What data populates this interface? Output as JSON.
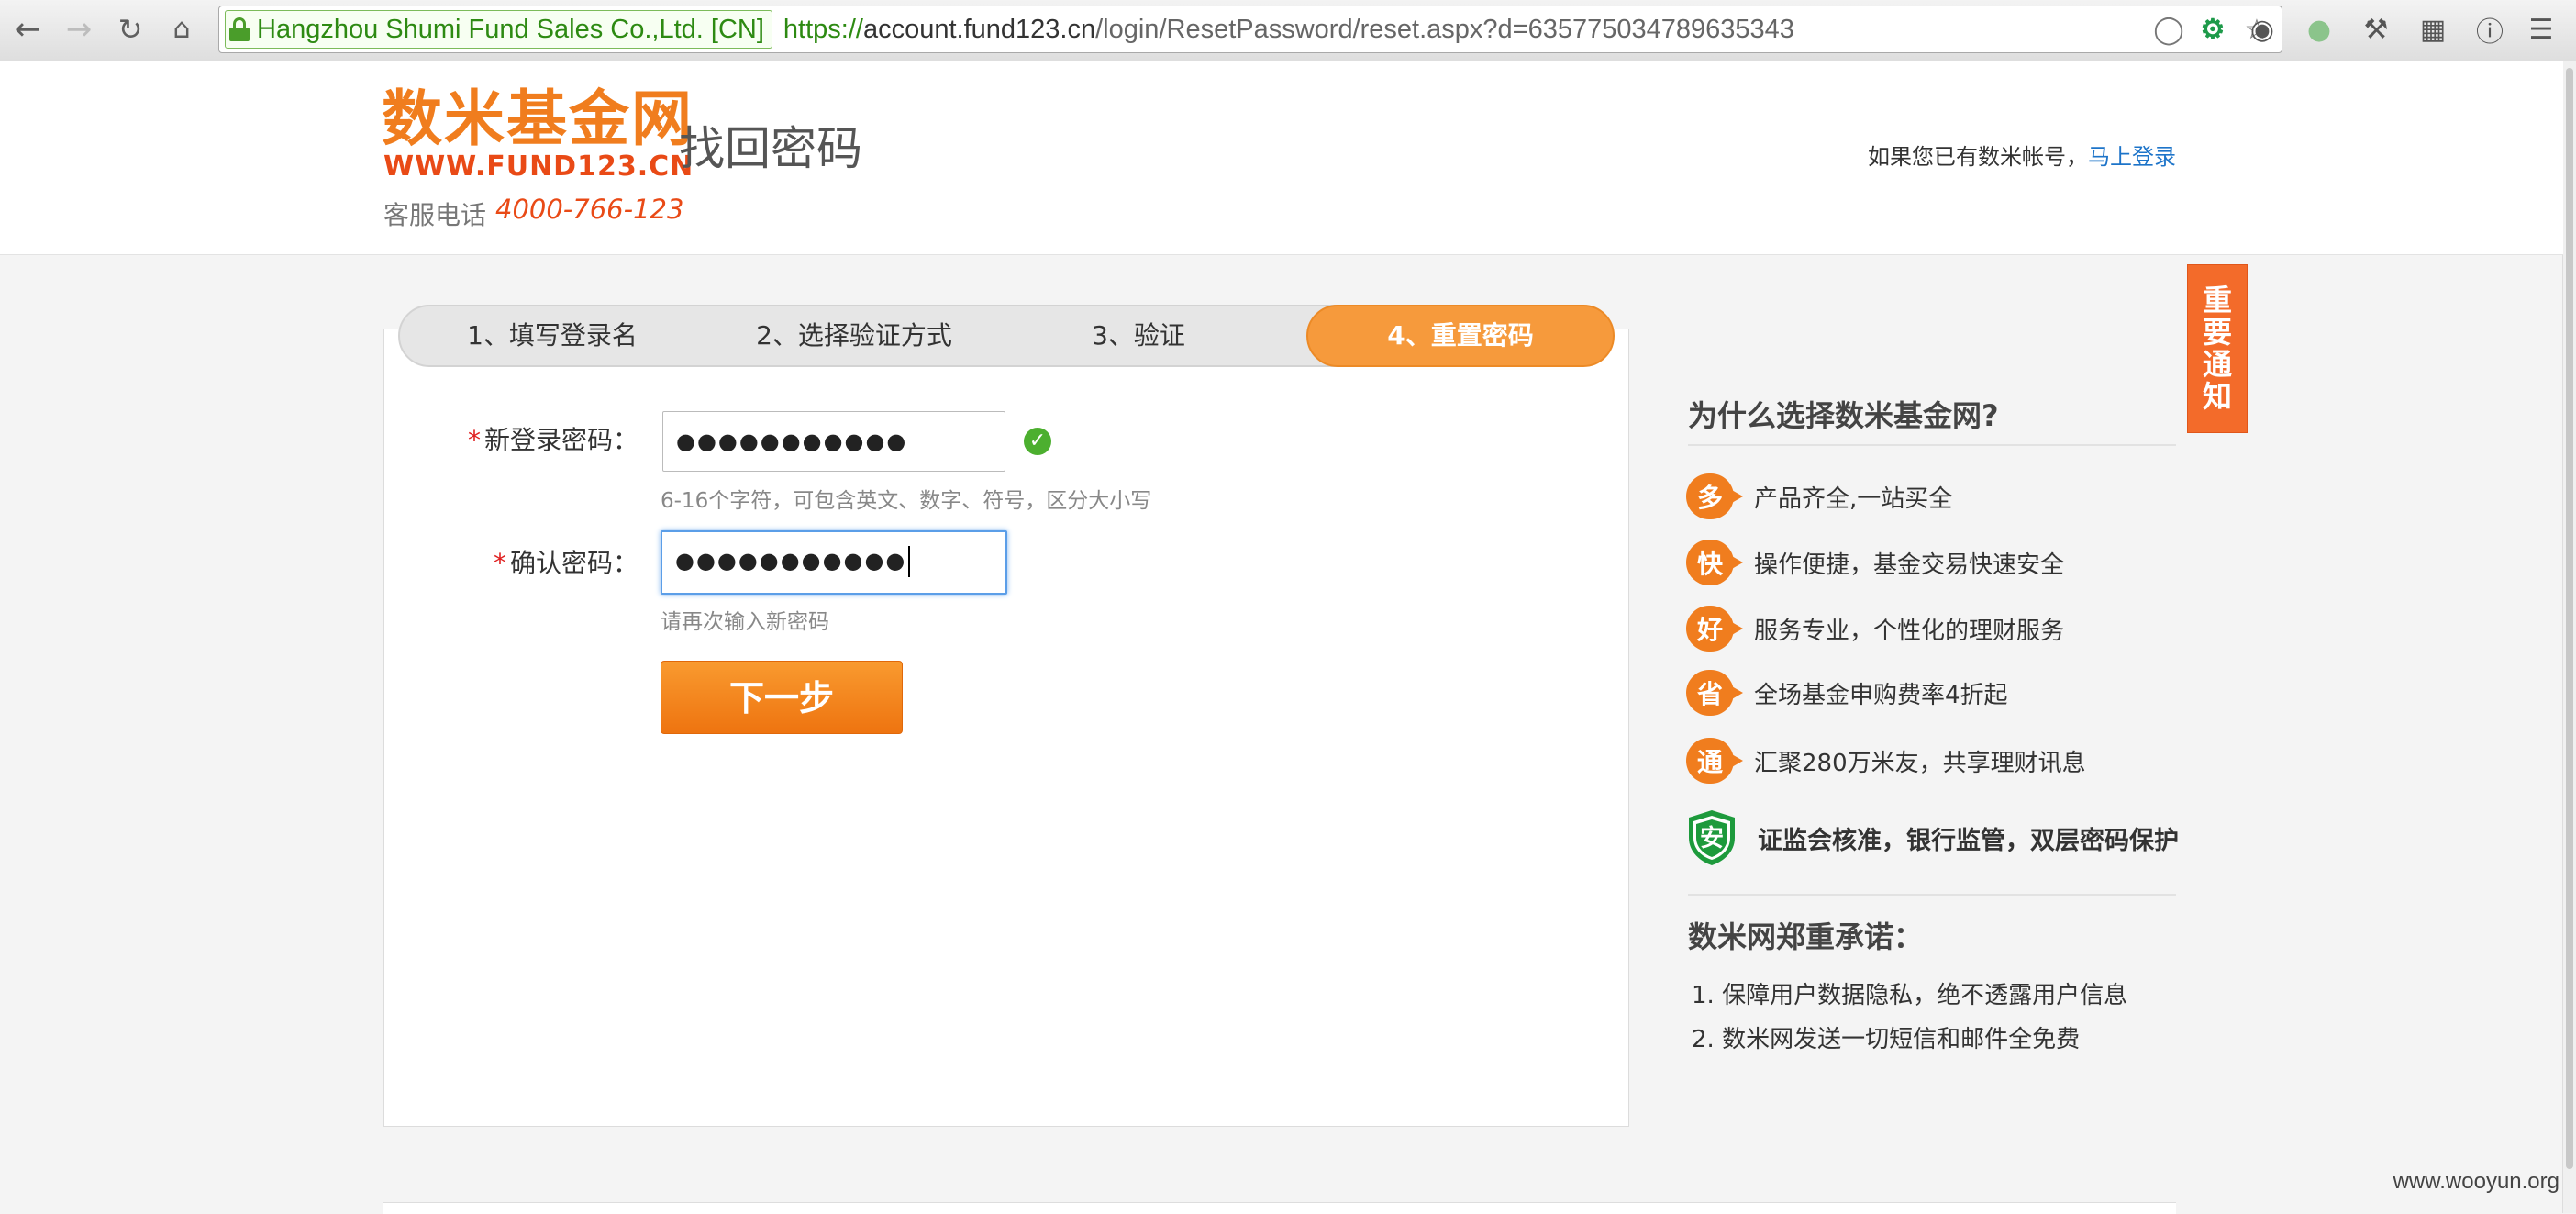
{
  "browser": {
    "ev_label": "Hangzhou Shumi Fund Sales Co.,Ltd. [CN]",
    "url_scheme": "https://",
    "url_host": "account.fund123.cn",
    "url_path": "/login/ResetPassword/reset.aspx?d=635775034789635343"
  },
  "header": {
    "logo_cn": "数米基金网",
    "logo_url": "WWW.FUND123.CN",
    "page_title": "找回密码",
    "hotline_label": "客服电话",
    "hotline_number": "4000-766-123",
    "login_prompt": "如果您已有数米帐号，",
    "login_link": "马上登录"
  },
  "steps": [
    {
      "label": "1、填写登录名",
      "active": false
    },
    {
      "label": "2、选择验证方式",
      "active": false
    },
    {
      "label": "3、验证",
      "active": false
    },
    {
      "label": "4、重置密码",
      "active": true
    }
  ],
  "form": {
    "required_mark": "*",
    "new_password_label": "新登录密码：",
    "new_password_value": "●●●●●●●●●●●",
    "new_password_hint": "6-16个字符，可包含英文、数字、符号，区分大小写",
    "confirm_password_label": "确认密码：",
    "confirm_password_value": "●●●●●●●●●●●",
    "confirm_password_hint": "请再次输入新密码",
    "next_button": "下一步"
  },
  "sidebar": {
    "title": "为什么选择数米基金网?",
    "features": [
      {
        "badge": "多",
        "text": "产品齐全,一站买全"
      },
      {
        "badge": "快",
        "text": "操作便捷，基金交易快速安全"
      },
      {
        "badge": "好",
        "text": "服务专业，个性化的理财服务"
      },
      {
        "badge": "省",
        "text": "全场基金申购费率4折起"
      },
      {
        "badge": "通",
        "text": "汇聚280万米友，共享理财讯息"
      }
    ],
    "security_badge": "安",
    "security_text": "证监会核准，银行监管，双层密码保护",
    "promise_title": "数米网郑重承诺：",
    "promises": [
      "1. 保障用户数据隐私，绝不透露用户信息",
      "2. 数米网发送一切短信和邮件全免费"
    ]
  },
  "notice_tab": [
    "重",
    "要",
    "通",
    "知"
  ],
  "watermark": "www.wooyun.org",
  "colors": {
    "brand_orange": "#f07d1e",
    "active_step": "#f69a3c",
    "link_blue": "#1d74c9",
    "success_green": "#4caf2f"
  }
}
